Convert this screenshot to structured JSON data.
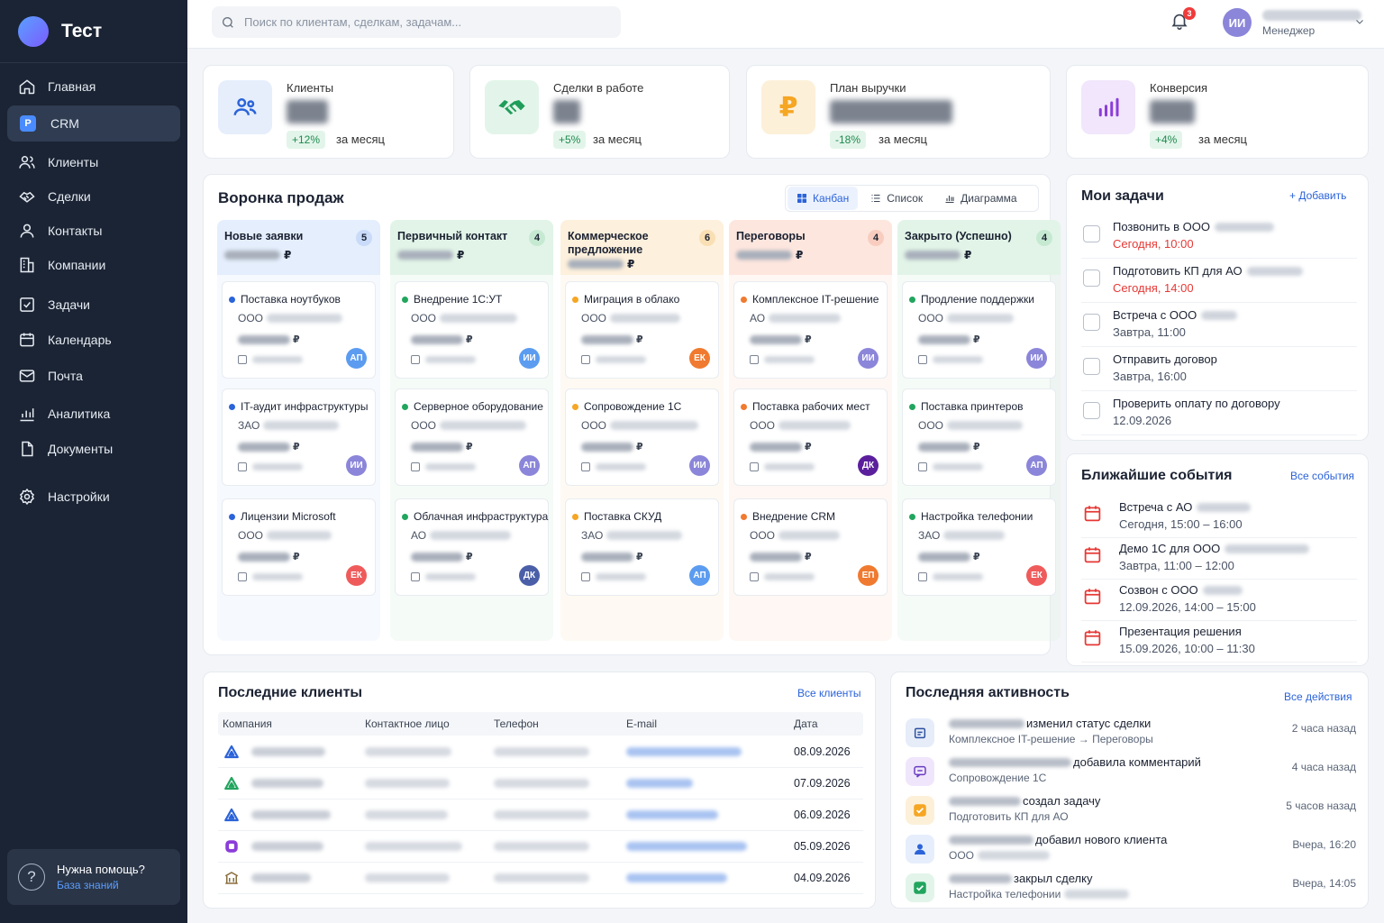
{
  "app": {
    "title": "Тест"
  },
  "nav": [
    {
      "label": "Главная",
      "icon": "home-icon"
    },
    {
      "label": "CRM",
      "icon": "crm-icon",
      "active": true
    },
    {
      "label": "Клиенты",
      "icon": "users-icon"
    },
    {
      "label": "Сделки",
      "icon": "handshake-icon"
    },
    {
      "label": "Контакты",
      "icon": "contact-icon"
    },
    {
      "label": "Компании",
      "icon": "building-icon"
    },
    {
      "label": "Задачи",
      "icon": "checkbox-icon"
    },
    {
      "label": "Календарь",
      "icon": "calendar-icon"
    },
    {
      "label": "Почта",
      "icon": "mail-icon"
    },
    {
      "label": "Аналитика",
      "icon": "chart-icon"
    },
    {
      "label": "Документы",
      "icon": "document-icon"
    },
    {
      "label": "Настройки",
      "icon": "gear-icon"
    }
  ],
  "help": {
    "title": "Нужна помощь?",
    "link": "База знаний",
    "icon": "question-icon"
  },
  "topbar": {
    "search_placeholder": "Поиск по клиентам, сделкам, задачам...",
    "notifications_count": "3",
    "user_initials": "ИИ",
    "user_role": "Менеджер"
  },
  "stats": [
    {
      "label": "Клиенты",
      "change": "+12%",
      "period": "за месяц",
      "positive": true,
      "icon": "users-icon",
      "color": "#2b63d9",
      "bg": "#e6eefc"
    },
    {
      "label": "Сделки в работе",
      "change": "+5%",
      "period": "за месяц",
      "positive": true,
      "icon": "handshake-icon",
      "color": "#1f9d5a",
      "bg": "#e3f5ea"
    },
    {
      "label": "План выручки",
      "change": "-18%",
      "period": "за месяц",
      "positive": true,
      "icon": "ruble-icon",
      "color": "#f5a623",
      "bg": "#fdf0d9"
    },
    {
      "label": "Конверсия",
      "change": "+4%",
      "period": "за месяц",
      "positive": true,
      "icon": "bar-chart-icon",
      "color": "#8b3dd9",
      "bg": "#f1e6fb"
    }
  ],
  "funnel": {
    "title": "Воронка продаж",
    "views": [
      "Канбан",
      "Список",
      "Диаграмма"
    ],
    "currency": "₽",
    "columns": [
      {
        "title": "Новые заявки",
        "count": "5",
        "bg": "#e4eefc",
        "badge": "#c9dbf8",
        "dot": "#2b63d9",
        "deals": [
          {
            "title": "Поставка ноутбуков",
            "org": "ООО",
            "initials": "АП",
            "av": "#5b9cf0"
          },
          {
            "title": "IT-аудит инфраструктуры",
            "org": "ЗАО",
            "initials": "ИИ",
            "av": "#8b86d9"
          },
          {
            "title": "Лицензии Microsoft",
            "org": "ООО",
            "initials": "ЕК",
            "av": "#ef5b5b"
          }
        ]
      },
      {
        "title": "Первичный контакт",
        "count": "4",
        "bg": "#e2f4e8",
        "badge": "#c6e9d2",
        "dot": "#22a55e",
        "deals": [
          {
            "title": "Внедрение 1С:УТ",
            "org": "ООО",
            "initials": "ИИ",
            "av": "#5b9cf0"
          },
          {
            "title": "Серверное оборудование",
            "org": "ООО",
            "initials": "АП",
            "av": "#8b86d9"
          },
          {
            "title": "Облачная инфраструктура",
            "org": "АО",
            "initials": "ДК",
            "av": "#4a5fa8"
          }
        ]
      },
      {
        "title": "Коммерческое предложение",
        "count": "6",
        "bg": "#fdf0dc",
        "badge": "#f9dfb3",
        "dot": "#f5a623",
        "deals": [
          {
            "title": "Миграция в облако",
            "org": "ООО",
            "initials": "ЕК",
            "av": "#f07a2f"
          },
          {
            "title": "Сопровождение 1С",
            "org": "ООО",
            "initials": "ИИ",
            "av": "#8b86d9"
          },
          {
            "title": "Поставка СКУД",
            "org": "ЗАО",
            "initials": "АП",
            "av": "#5b9cf0"
          }
        ]
      },
      {
        "title": "Переговоры",
        "count": "4",
        "bg": "#fde6de",
        "badge": "#f8cdbf",
        "dot": "#f07a2f",
        "deals": [
          {
            "title": "Комплексное IT-решение",
            "org": "АО",
            "initials": "ИИ",
            "av": "#8b86d9"
          },
          {
            "title": "Поставка рабочих мест",
            "org": "ООО",
            "initials": "ДК",
            "av": "#5b1f9d"
          },
          {
            "title": "Внедрение CRM",
            "org": "ООО",
            "initials": "ЕП",
            "av": "#f07a2f"
          }
        ]
      },
      {
        "title": "Закрыто (Успешно)",
        "count": "4",
        "bg": "#e2f4e8",
        "badge": "#c6e9d2",
        "dot": "#22a55e",
        "deals": [
          {
            "title": "Продление поддержки",
            "org": "ООО",
            "initials": "ИИ",
            "av": "#8b86d9"
          },
          {
            "title": "Поставка принтеров",
            "org": "ООО",
            "initials": "АП",
            "av": "#8b86d9"
          },
          {
            "title": "Настройка телефонии",
            "org": "ЗАО",
            "initials": "ЕК",
            "av": "#ef5b5b"
          }
        ]
      }
    ]
  },
  "tasks": {
    "title": "Мои задачи",
    "add": "+ Добавить",
    "items": [
      {
        "title": "Позвонить в ООО",
        "when": "Сегодня, 10:00",
        "urgent": true
      },
      {
        "title": "Подготовить КП для АО",
        "when": "Сегодня, 14:00",
        "urgent": true
      },
      {
        "title": "Встреча с ООО",
        "when": "Завтра, 11:00",
        "urgent": false
      },
      {
        "title": "Отправить договор",
        "when": "Завтра, 16:00",
        "urgent": false
      },
      {
        "title": "Проверить оплату по договору",
        "when": "12.09.2026",
        "urgent": false
      }
    ]
  },
  "events": {
    "title": "Ближайшие события",
    "link": "Все события",
    "items": [
      {
        "title": "Встреча с АО",
        "when": "Сегодня, 15:00 – 16:00"
      },
      {
        "title": "Демо 1С для ООО",
        "when": "Завтра, 11:00 – 12:00"
      },
      {
        "title": "Созвон с ООО",
        "when": "12.09.2026, 14:00 – 15:00"
      },
      {
        "title": "Презентация решения",
        "when": "15.09.2026, 10:00 – 11:30"
      }
    ]
  },
  "clients": {
    "title": "Последние клиенты",
    "link": "Все клиенты",
    "headers": [
      "Компания",
      "Контактное лицо",
      "Телефон",
      "E-mail",
      "Дата"
    ],
    "rows": [
      {
        "date": "08.09.2026",
        "logo": "triangle-logo-icon",
        "color": "#2b63d9"
      },
      {
        "date": "07.09.2026",
        "logo": "green-triangle-logo-icon",
        "color": "#22a55e"
      },
      {
        "date": "06.09.2026",
        "logo": "triangle-logo-icon",
        "color": "#2b63d9"
      },
      {
        "date": "05.09.2026",
        "logo": "purple-logo-icon",
        "color": "#8b3dd9"
      },
      {
        "date": "04.09.2026",
        "logo": "building-logo-icon",
        "color": "#8a6d3b"
      }
    ]
  },
  "activity": {
    "title": "Последняя активность",
    "link": "Все действия",
    "items": [
      {
        "action": "изменил статус сделки",
        "detail": "Комплексное IT-решение → Переговоры",
        "time": "2 часа назад",
        "icon": "status-icon",
        "color": "#2b4fa0",
        "bg": "#e6ecf8"
      },
      {
        "action": "добавила комментарий",
        "detail": "Сопровождение 1С",
        "time": "4 часа назад",
        "icon": "comment-icon",
        "color": "#6a3bc2",
        "bg": "#efe6fb"
      },
      {
        "action": "создал задачу",
        "detail": "Подготовить КП для АО",
        "time": "5 часов назад",
        "icon": "task-icon",
        "color": "#f5a623",
        "bg": "#fdf0d9"
      },
      {
        "action": "добавил нового клиента",
        "detail": "ООО",
        "time": "Вчера, 16:20",
        "icon": "user-add-icon",
        "color": "#2b63d9",
        "bg": "#e6eefc"
      },
      {
        "action": "закрыл сделку",
        "detail": "Настройка телефонии",
        "time": "Вчера, 14:05",
        "icon": "check-icon",
        "color": "#22a55e",
        "bg": "#e3f5ea"
      }
    ]
  }
}
